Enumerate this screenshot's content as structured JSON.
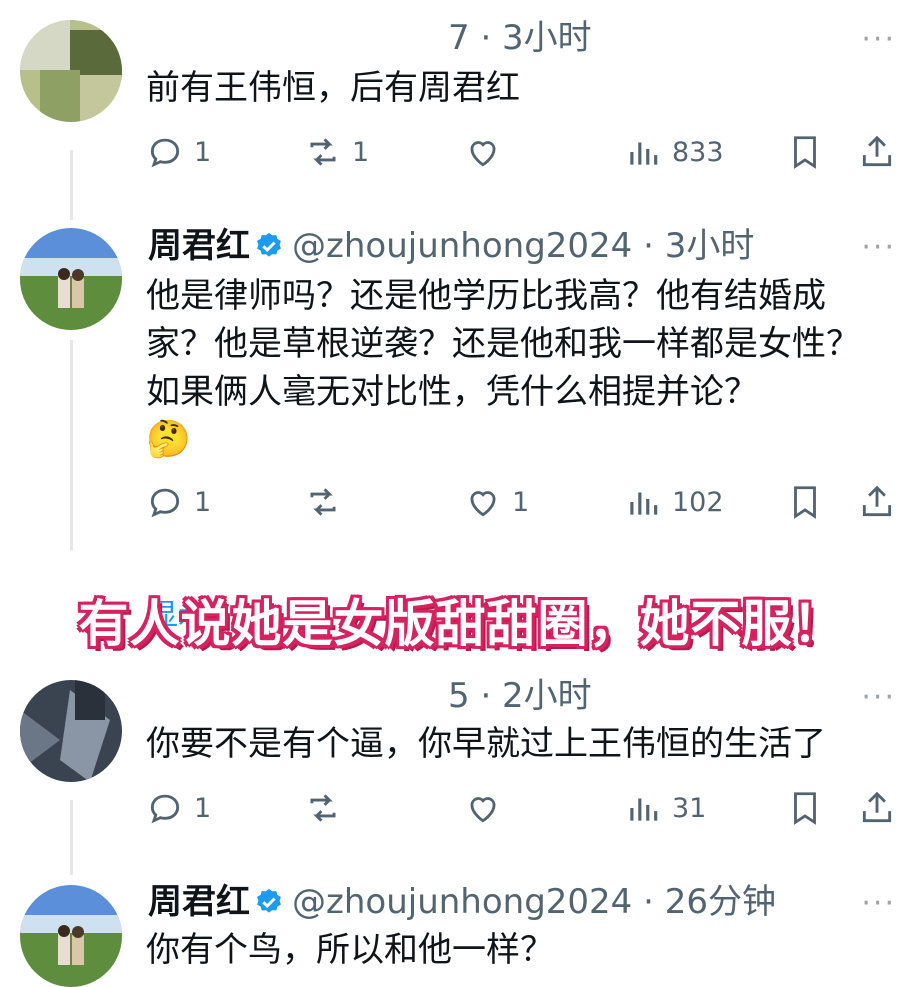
{
  "tweets": [
    {
      "meta_hidden": "      ",
      "meta_tail": "7 · 3小时",
      "text": "前有王伟恒，后有周君红",
      "actions": {
        "reply": "1",
        "retweet": "1",
        "like": "",
        "views": "833"
      }
    },
    {
      "name": "周君红",
      "handle": "@zhoujunhong2024",
      "time": "· 3小时",
      "text": "他是律师吗？还是他学历比我高？他有结婚成家？他是草根逆袭？还是他和我一样都是女性？如果俩人毫无对比性，凭什么相提并论？",
      "emoji": "🤔",
      "actions": {
        "reply": "1",
        "retweet": "",
        "like": "1",
        "views": "102"
      }
    },
    {
      "meta_hidden": "             ",
      "meta_tail": "5 · 2小时",
      "text": "你要不是有个逼，你早就过上王伟恒的生活了",
      "actions": {
        "reply": "1",
        "retweet": "",
        "like": "",
        "views": "31"
      }
    },
    {
      "name": "周君红",
      "handle": "@zhoujunhong2024",
      "time": "· 26分钟",
      "text": "你有个鸟，所以和他一样？"
    }
  ],
  "show_more": "显示",
  "overlay_caption": "有人说她是女版甜甜圈，她不服！",
  "more_menu": "···",
  "colors": {
    "accent": "#1d9bf0",
    "overlay": "#d6225f",
    "muted": "#536471"
  }
}
